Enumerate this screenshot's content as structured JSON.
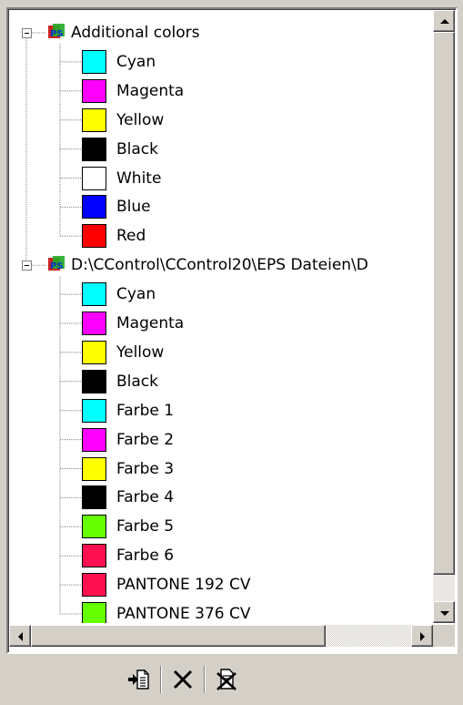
{
  "tree": {
    "groups": [
      {
        "label": "Additional colors",
        "expanded": true,
        "items": [
          {
            "label": "Cyan",
            "color": "#00ffff"
          },
          {
            "label": "Magenta",
            "color": "#ff00ff"
          },
          {
            "label": "Yellow",
            "color": "#ffff00"
          },
          {
            "label": "Black",
            "color": "#000000"
          },
          {
            "label": "White",
            "color": "#ffffff"
          },
          {
            "label": "Blue",
            "color": "#0000ff"
          },
          {
            "label": "Red",
            "color": "#ff0000"
          }
        ]
      },
      {
        "label": "D:\\CControl\\CControl20\\EPS Dateien\\D",
        "expanded": true,
        "items": [
          {
            "label": "Cyan",
            "color": "#00ffff"
          },
          {
            "label": "Magenta",
            "color": "#ff00ff"
          },
          {
            "label": "Yellow",
            "color": "#ffff00"
          },
          {
            "label": "Black",
            "color": "#000000"
          },
          {
            "label": "Farbe 1",
            "color": "#00ffff"
          },
          {
            "label": "Farbe 2",
            "color": "#ff00ff"
          },
          {
            "label": "Farbe 3",
            "color": "#ffff00"
          },
          {
            "label": "Farbe 4",
            "color": "#000000"
          },
          {
            "label": "Farbe 5",
            "color": "#66ff00"
          },
          {
            "label": "Farbe 6",
            "color": "#ff1050"
          },
          {
            "label": "PANTONE 192 CV",
            "color": "#ff1050"
          },
          {
            "label": "PANTONE 376 CV",
            "color": "#66ff00"
          }
        ]
      }
    ]
  },
  "toolbar": {
    "buttons": [
      {
        "name": "import-colors-button",
        "icon": "import-document-icon"
      },
      {
        "name": "delete-button",
        "icon": "x-delete-icon"
      },
      {
        "name": "delete-all-button",
        "icon": "delete-all-icon"
      }
    ]
  },
  "colors": {
    "window_bg": "#d4d0c8",
    "tree_bg": "#ffffff",
    "line": "#808080"
  }
}
